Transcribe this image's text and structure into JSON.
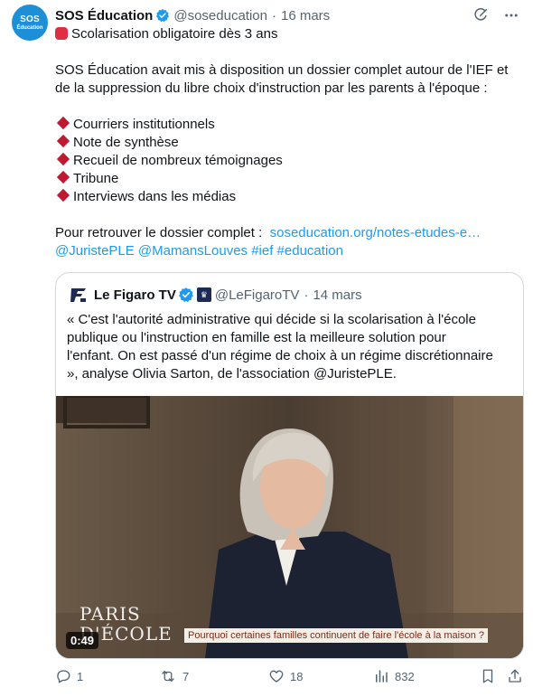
{
  "author": {
    "avatar_line1": "SOS",
    "avatar_line2": "Éducation",
    "name": "SOS Éducation",
    "handle": "@soseducation",
    "separator": "·",
    "date": "16 mars"
  },
  "tweet": {
    "line1": "Scolarisation obligatoire dès 3 ans",
    "para1_line1": "SOS Éducation avait mis à disposition un dossier complet autour de l'IEF et",
    "para1_line2": "de la suppression du libre choix d'instruction par les parents à l'époque :",
    "bullets": [
      "Courriers institutionnels",
      "Note de synthèse",
      "Recueil de nombreux témoignages",
      "Tribune",
      "Interviews dans les médias"
    ],
    "dossier_prefix": "Pour retrouver le dossier complet :",
    "dossier_link": "soseducation.org/notes-etudes-e…",
    "mentions": "@JuristePLE @MamansLouves #ief #education"
  },
  "quote": {
    "name": "Le Figaro TV",
    "gov_badge": "♛",
    "handle": "@LeFigaroTV",
    "separator": "·",
    "date": "14 mars",
    "text_lines": [
      "« C'est l'autorité administrative qui décide si la scolarisation à l'école",
      "publique ou l'instruction en famille est la meilleure solution pour",
      "l'enfant. On est passé d'un régime de choix à un régime discrétionnaire",
      "», analyse Olivia Sarton, de l'association  @JuristePLE."
    ],
    "video": {
      "duration": "0:49",
      "overlay_line1": "PARIS",
      "overlay_line2": "D'ÉCOLE",
      "caption": "Pourquoi certaines familles continuent de faire l'école à la maison ?"
    }
  },
  "actions": {
    "replies": "1",
    "retweets": "7",
    "likes": "18",
    "views": "832"
  },
  "colors": {
    "accent": "#1d9bf0",
    "muted": "#536471",
    "diamond": "#be1931",
    "border": "#cfd9de"
  },
  "icons": [
    "verified-badge-icon",
    "grok-icon",
    "more-icon",
    "figaro-logo-icon",
    "reply-icon",
    "retweet-icon",
    "like-icon",
    "views-icon",
    "bookmark-icon",
    "share-icon"
  ]
}
